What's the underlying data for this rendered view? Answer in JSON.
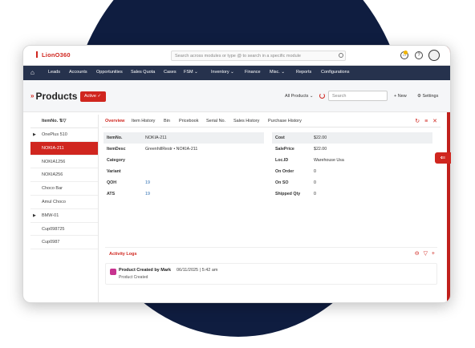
{
  "app": {
    "logo": "LionO360"
  },
  "header": {
    "search_placeholder": "Search across modules or type @ to search in a specific module"
  },
  "nav": {
    "items": [
      "Leads",
      "Accounts",
      "Opportunities",
      "Sales Quota",
      "Cases",
      "FSM ⌄",
      "Inventory ⌄",
      "Finance",
      "Misc. ⌄",
      "Reports",
      "Configurations"
    ]
  },
  "page": {
    "title": "Products",
    "status": "Active ✓",
    "filter": "All Products ⌄",
    "search_placeholder": "Search",
    "new_label": "+ New",
    "settings_label": "⚙ Settings"
  },
  "list": {
    "header": "ItemNo.",
    "items": [
      {
        "label": "OnePlus 510",
        "expandable": true
      },
      {
        "label": "NOKIA-211",
        "selected": true
      },
      {
        "label": "NOKIA1256"
      },
      {
        "label": "NOKIA256"
      },
      {
        "label": "Choco Bar"
      },
      {
        "label": "Amul Choco"
      },
      {
        "label": "BMW-01",
        "expandable": true
      },
      {
        "label": "Cup098725"
      },
      {
        "label": "Cup0987"
      }
    ]
  },
  "tabs": [
    "Overview",
    "Item History",
    "Bin",
    "Pricebook",
    "Serial No.",
    "Sales History",
    "Purchase History"
  ],
  "fields_left": [
    {
      "label": "ItemNo.",
      "value": "NOKIA-211"
    },
    {
      "label": "ItemDesc",
      "value": "GreenhillRestr • NOKIA-211"
    },
    {
      "label": "Category",
      "value": ""
    },
    {
      "label": "Variant",
      "value": ""
    },
    {
      "label": "QOH",
      "value": "19"
    },
    {
      "label": "ATS",
      "value": "19"
    }
  ],
  "fields_right": [
    {
      "label": "Cost",
      "value": "$22.00"
    },
    {
      "label": "SalePrice",
      "value": "$22.00"
    },
    {
      "label": "Loc.ID",
      "value": "Warehouse Usa"
    },
    {
      "label": "On Order",
      "value": "0"
    },
    {
      "label": "On SO",
      "value": "0"
    },
    {
      "label": "Shipped Qty",
      "value": "0"
    }
  ],
  "activity": {
    "title": "Activity Logs",
    "entry_title": "Product Created by Mark",
    "entry_time": "06/11/2025 | 5:42 am",
    "entry_sub": "Product Created"
  },
  "colors": {
    "accent": "#d0261f",
    "nav": "#26324d",
    "background_circle": "#0f1d40"
  }
}
